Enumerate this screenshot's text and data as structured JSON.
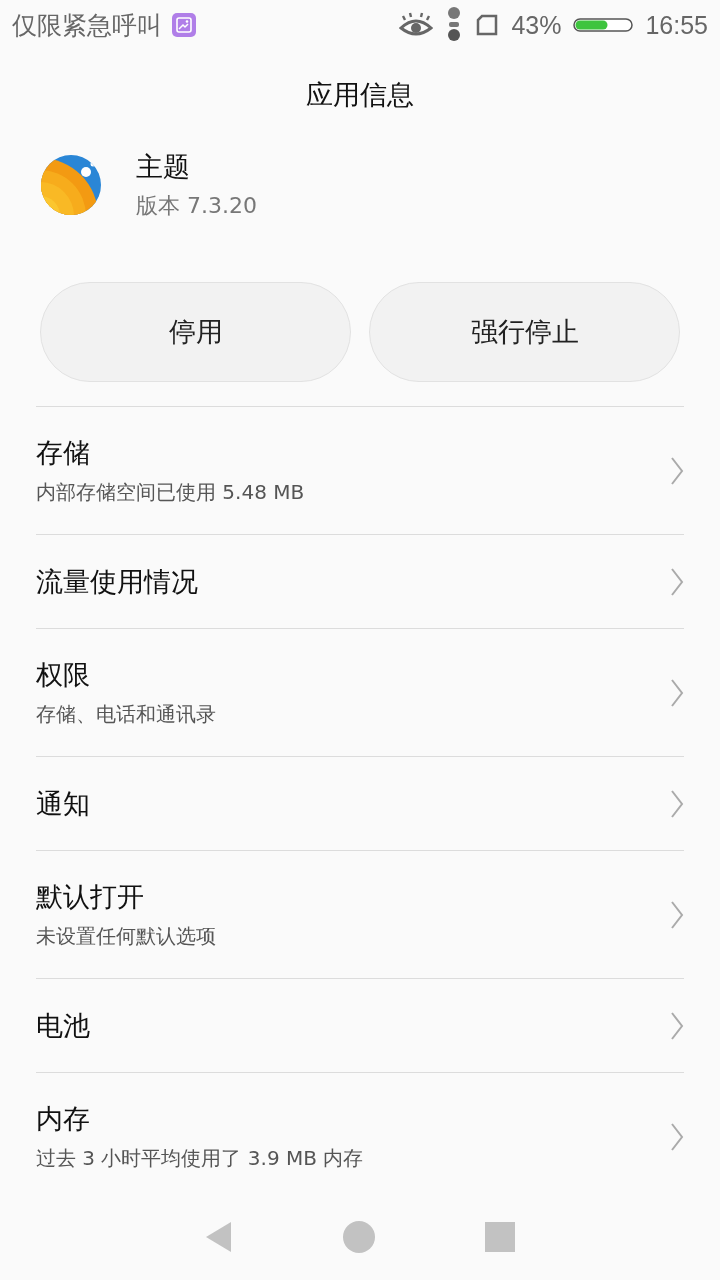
{
  "status_bar": {
    "carrier": "仅限紧急呼叫",
    "battery": "43%",
    "time": "16:55"
  },
  "title": "应用信息",
  "app": {
    "name": "主题",
    "version": "版本 7.3.20"
  },
  "buttons": [
    "停用",
    "强行停止"
  ],
  "items": [
    {
      "title": "存储",
      "subtitle": "内部存储空间已使用 5.48 MB"
    },
    {
      "title": "流量使用情况"
    },
    {
      "title": "权限",
      "subtitle": "存储、电话和通讯录"
    },
    {
      "title": "通知"
    },
    {
      "title": "默认打开",
      "subtitle": "未设置任何默认选项"
    },
    {
      "title": "电池"
    },
    {
      "title": "内存",
      "subtitle": "过去 3 小时平均使用了 3.9 MB 内存"
    }
  ]
}
